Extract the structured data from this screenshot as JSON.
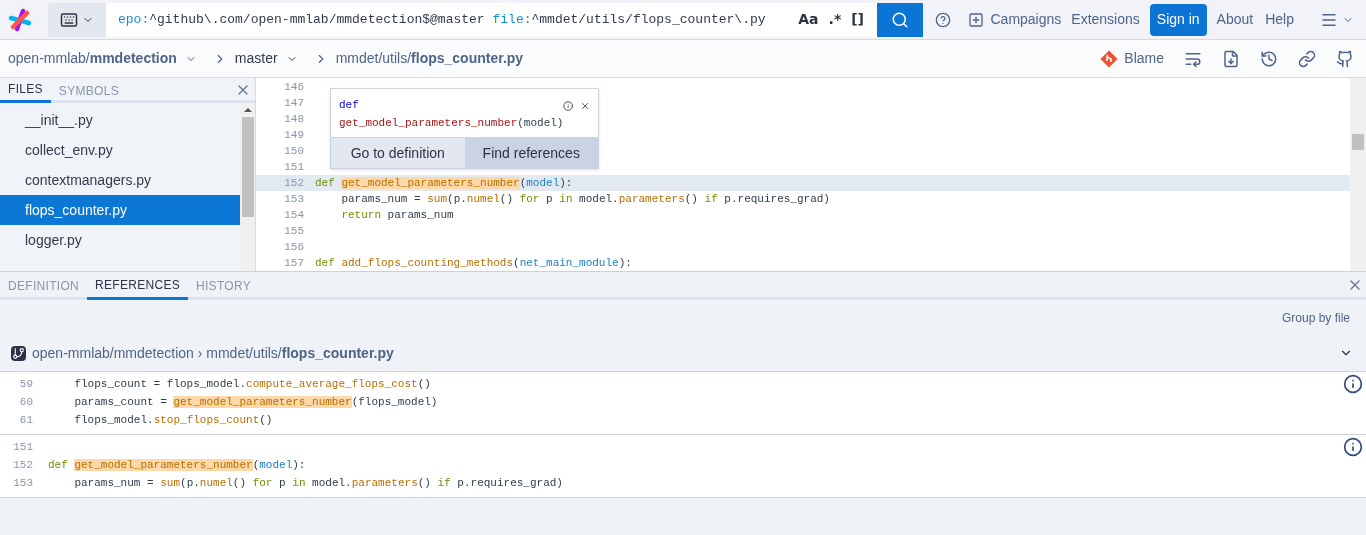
{
  "top_bar": {
    "keyboard_button": {
      "expanded": false
    },
    "query": [
      {
        "text": "epo:",
        "kind": "filter"
      },
      {
        "text": "^github\\.com/open-mmlab/mmdetection$@master ",
        "kind": "value"
      },
      {
        "text": "file:",
        "kind": "filter"
      },
      {
        "text": "^mmdet/utils/flops_counter\\.py",
        "kind": "value"
      }
    ],
    "toggles": [
      "Aa",
      ".*",
      "[]"
    ],
    "links": [
      {
        "label": "Campaigns",
        "kind": "icon_link"
      },
      {
        "label": "Extensions",
        "kind": "link"
      },
      {
        "label": "Sign in",
        "kind": "primary"
      },
      {
        "label": "About",
        "kind": "link"
      },
      {
        "label": "Help",
        "kind": "link"
      }
    ]
  },
  "breadcrumb": {
    "repo": "open-mmlab/**mmdetection**",
    "revision": "master",
    "path": "mmdet/utils/**flops_counter.py**",
    "actions": [
      {
        "label": "Blame"
      }
    ]
  },
  "sidebar": {
    "tabs": [
      {
        "label": "FILES",
        "selected": true
      },
      {
        "label": "SYMBOLS",
        "selected": false
      }
    ],
    "files": [
      {
        "name": "__init__.py",
        "selected": false
      },
      {
        "name": "collect_env.py",
        "selected": false
      },
      {
        "name": "contextmanagers.py",
        "selected": false
      },
      {
        "name": "flops_counter.py",
        "selected": true
      },
      {
        "name": "logger.py",
        "selected": false
      }
    ]
  },
  "code": {
    "lines": [
      {
        "num": "146",
        "selected": false
      },
      {
        "num": "147",
        "selected": false
      },
      {
        "num": "148",
        "selected": false
      },
      {
        "num": "149",
        "selected": false
      },
      {
        "num": "150",
        "selected": false
      },
      {
        "num": "151",
        "selected": false
      },
      {
        "num": "152",
        "selected": true,
        "tokens": [
          {
            "text": "def ",
            "kind": "keyword"
          },
          {
            "text": "get_model_parameters_number",
            "kind": "match"
          },
          {
            "text": "(",
            "kind": "plain"
          },
          {
            "text": "model",
            "kind": "param"
          },
          {
            "text": "):",
            "kind": "plain"
          }
        ]
      },
      {
        "num": "153",
        "selected": false,
        "tokens": [
          {
            "text": "    params_num = ",
            "kind": "plain"
          },
          {
            "text": "sum",
            "kind": "function"
          },
          {
            "text": "(p.",
            "kind": "plain"
          },
          {
            "text": "numel",
            "kind": "function"
          },
          {
            "text": "() ",
            "kind": "plain"
          },
          {
            "text": "for",
            "kind": "keyword"
          },
          {
            "text": " p ",
            "kind": "plain"
          },
          {
            "text": "in",
            "kind": "keyword"
          },
          {
            "text": " model.",
            "kind": "plain"
          },
          {
            "text": "parameters",
            "kind": "function"
          },
          {
            "text": "() ",
            "kind": "plain"
          },
          {
            "text": "if",
            "kind": "keyword"
          },
          {
            "text": " p.requires_grad)",
            "kind": "plain"
          }
        ]
      },
      {
        "num": "154",
        "selected": false,
        "tokens": [
          {
            "text": "    return",
            "kind": "keyword"
          },
          {
            "text": " params_num",
            "kind": "plain"
          }
        ]
      },
      {
        "num": "155",
        "selected": false
      },
      {
        "num": "156",
        "selected": false
      },
      {
        "num": "157",
        "selected": false,
        "tokens": [
          {
            "text": "def ",
            "kind": "keyword"
          },
          {
            "text": "add_flops_counting_methods",
            "kind": "function"
          },
          {
            "text": "(",
            "kind": "plain"
          },
          {
            "text": "net_main_module",
            "kind": "param"
          },
          {
            "text": "):",
            "kind": "plain"
          }
        ]
      }
    ]
  },
  "hover": {
    "keyword": "def",
    "signature": [
      {
        "text": "get_model_parameters_number",
        "kind": "name"
      },
      {
        "text": "(model)",
        "kind": "plain"
      }
    ],
    "actions": [
      {
        "label": "Go to definition",
        "selected": false
      },
      {
        "label": "Find references",
        "selected": true
      }
    ]
  },
  "panel": {
    "tabs": [
      {
        "label": "DEFINITION",
        "selected": false
      },
      {
        "label": "REFERENCES",
        "selected": true
      },
      {
        "label": "HISTORY",
        "selected": false
      }
    ],
    "group_by": "Group by file",
    "repo_header": "open-mmlab/mmdetection › mmdet/utils/**flops_counter.py**",
    "groups": [
      {
        "lines": [
          {
            "num": "59",
            "tokens": [
              {
                "text": "    flops_count = flops_model.",
                "kind": "plain"
              },
              {
                "text": "compute_average_flops_cost",
                "kind": "function"
              },
              {
                "text": "()",
                "kind": "plain"
              }
            ]
          },
          {
            "num": "60",
            "tokens": [
              {
                "text": "    params_count = ",
                "kind": "plain"
              },
              {
                "text": "get_model_parameters_number",
                "kind": "match"
              },
              {
                "text": "(flops_model)",
                "kind": "plain"
              }
            ]
          },
          {
            "num": "61",
            "tokens": [
              {
                "text": "    flops_model.",
                "kind": "plain"
              },
              {
                "text": "stop_flops_count",
                "kind": "function"
              },
              {
                "text": "()",
                "kind": "plain"
              }
            ]
          }
        ]
      },
      {
        "lines": [
          {
            "num": "151"
          },
          {
            "num": "152",
            "tokens": [
              {
                "text": "def ",
                "kind": "keyword"
              },
              {
                "text": "get_model_parameters_number",
                "kind": "match"
              },
              {
                "text": "(",
                "kind": "plain"
              },
              {
                "text": "model",
                "kind": "param"
              },
              {
                "text": "):",
                "kind": "plain"
              }
            ]
          },
          {
            "num": "153",
            "tokens": [
              {
                "text": "    params_num = ",
                "kind": "plain"
              },
              {
                "text": "sum",
                "kind": "function"
              },
              {
                "text": "(p.",
                "kind": "plain"
              },
              {
                "text": "numel",
                "kind": "function"
              },
              {
                "text": "() ",
                "kind": "plain"
              },
              {
                "text": "for",
                "kind": "keyword"
              },
              {
                "text": " p ",
                "kind": "plain"
              },
              {
                "text": "in",
                "kind": "keyword"
              },
              {
                "text": " model.",
                "kind": "plain"
              },
              {
                "text": "parameters",
                "kind": "function"
              },
              {
                "text": "() ",
                "kind": "plain"
              },
              {
                "text": "if",
                "kind": "keyword"
              },
              {
                "text": " p.requires_grad)",
                "kind": "plain"
              }
            ]
          }
        ]
      }
    ]
  }
}
